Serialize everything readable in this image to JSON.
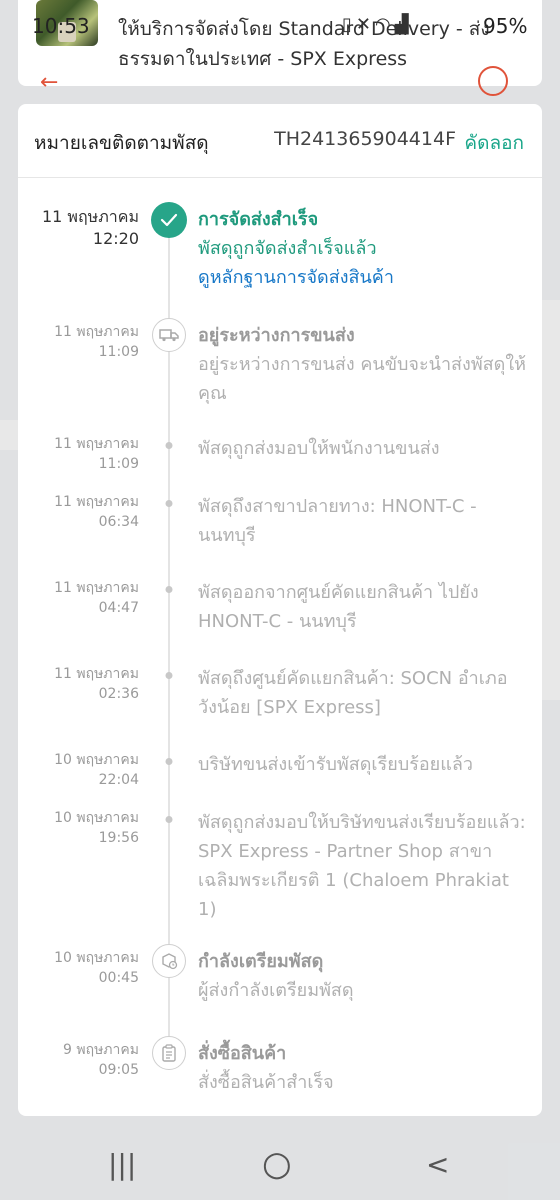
{
  "status_bar": {
    "time": "10:53",
    "icons": [
      "image-icon",
      "vibrate-icon",
      "mute-icon",
      "wifi-icon",
      "volte-icon",
      "signal-icon"
    ],
    "battery": "95%"
  },
  "top_card": {
    "line1": "ให้บริการจัดส่งโดย Standard Delivery - ส่ง",
    "line2": "ธรรมดาในประเทศ - SPX Express"
  },
  "tracking": {
    "label": "หมายเลขติดตามพัสดุ",
    "number": "TH241365904414F",
    "copy_label": "คัดลอก"
  },
  "events": [
    {
      "date": "11 พฤษภาคม",
      "time": "12:20",
      "title": "การจัดส่งสำเร็จ",
      "desc": "พัสดุถูกจัดส่งสำเร็จแล้ว",
      "link": "ดูหลักฐานการจัดส่งสินค้า",
      "icon": "check-icon"
    },
    {
      "date": "11 พฤษภาคม",
      "time": "11:09",
      "title": "อยู่ระหว่างการขนส่ง",
      "desc": "อยู่ระหว่างการขนส่ง คนขับจะนำส่งพัสดุให้คุณ",
      "icon": "truck-icon"
    },
    {
      "date": "11 พฤษภาคม",
      "time": "11:09",
      "desc": "พัสดุถูกส่งมอบให้พนักงานขนส่ง"
    },
    {
      "date": "11 พฤษภาคม",
      "time": "06:34",
      "desc": "พัสดุถึงสาขาปลายทาง: HNONT-C - นนทบุรี"
    },
    {
      "date": "11 พฤษภาคม",
      "time": "04:47",
      "desc": "พัสดุออกจากศูนย์คัดแยกสินค้า ไปยัง HNONT-C - นนทบุรี"
    },
    {
      "date": "11 พฤษภาคม",
      "time": "02:36",
      "desc": "พัสดุถึงศูนย์คัดแยกสินค้า: SOCN อำเภอวังน้อย [SPX Express]"
    },
    {
      "date": "10 พฤษภาคม",
      "time": "22:04",
      "desc": "บริษัทขนส่งเข้ารับพัสดุเรียบร้อยแล้ว"
    },
    {
      "date": "10 พฤษภาคม",
      "time": "19:56",
      "desc": "พัสดุถูกส่งมอบให้บริษัทขนส่งเรียบร้อยแล้ว: SPX Express - Partner Shop สาขาเฉลิมพระเกียรติ 1 (Chaloem Phrakiat 1)"
    },
    {
      "date": "10 พฤษภาคม",
      "time": "00:45",
      "title": "กำลังเตรียมพัสดุ",
      "desc": " ผู้ส่งกำลังเตรียมพัสดุ",
      "icon": "package-clock-icon"
    },
    {
      "date": "9 พฤษภาคม",
      "time": "09:05",
      "title": "สั่งซื้อสินค้า",
      "desc": "สั่งซื้อสินค้าสำเร็จ",
      "icon": "clipboard-icon"
    }
  ],
  "nav_bar": {
    "recents": "|||",
    "home": "○",
    "back": "<"
  },
  "colors": {
    "accent": "#1f9a7d",
    "link": "#1677c7",
    "muted": "#9a9a9a"
  }
}
